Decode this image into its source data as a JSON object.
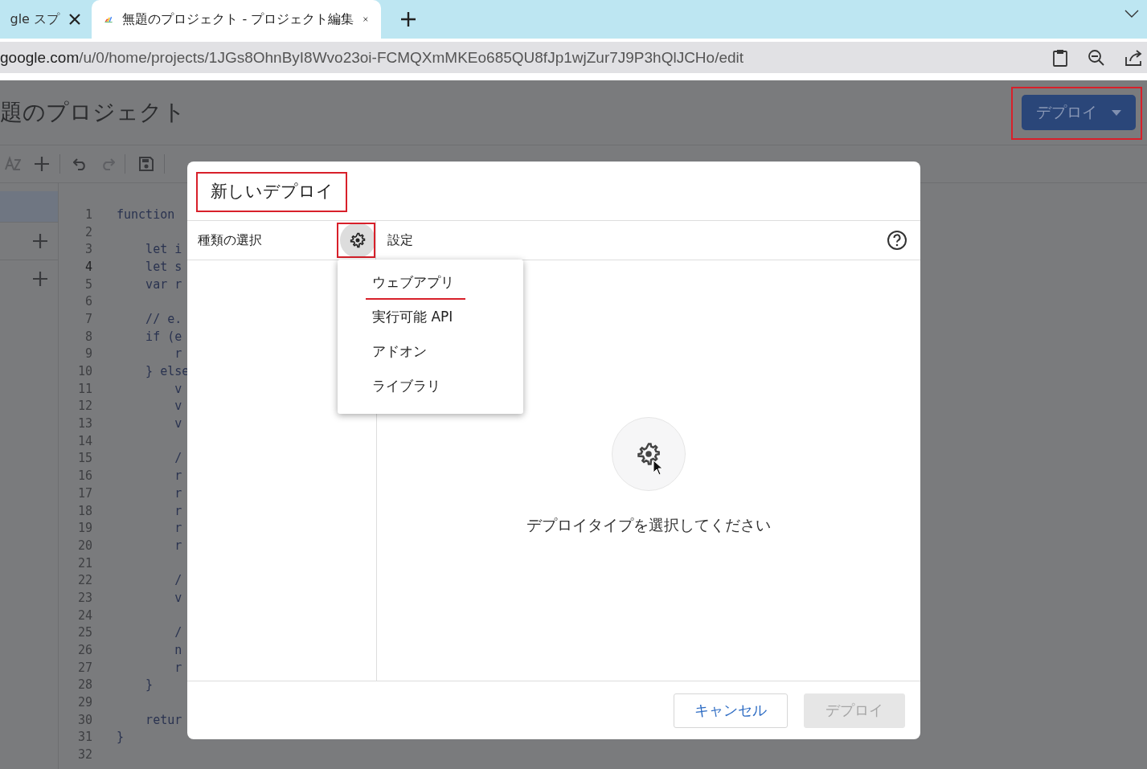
{
  "browser": {
    "tabs": [
      {
        "label": "gle スプ",
        "selected": false
      },
      {
        "label": "無題のプロジェクト - プロジェクト編集",
        "selected": true
      }
    ],
    "address": {
      "host": "google.com",
      "path": "/u/0/home/projects/1JGs8OhnByI8Wvo23oi-FCMQXmMKEo685QU8fJp1wjZur7J9P3hQlJCHo/edit"
    }
  },
  "app": {
    "title": "題のプロジェクト",
    "deploy_button": "デプロイ",
    "code_lines": [
      {
        "number": "1",
        "text": "function",
        "current": false
      },
      {
        "number": "2",
        "current": false
      },
      {
        "number": "3",
        "text": "    let i",
        "current": false
      },
      {
        "number": "4",
        "text": "    let s",
        "current": true
      },
      {
        "number": "5",
        "text": "    var r",
        "current": false
      },
      {
        "number": "6",
        "current": false
      },
      {
        "number": "7",
        "text": "    // e.",
        "current": false
      },
      {
        "number": "8",
        "text": "    if (e",
        "current": false
      },
      {
        "number": "9",
        "text": "        r",
        "current": false
      },
      {
        "number": "10",
        "text": "    } else",
        "current": false
      },
      {
        "number": "11",
        "text": "        v",
        "current": false
      },
      {
        "number": "12",
        "text": "        v",
        "current": false
      },
      {
        "number": "13",
        "text": "        v",
        "current": false
      },
      {
        "number": "14",
        "current": false
      },
      {
        "number": "15",
        "text": "        /",
        "current": false
      },
      {
        "number": "16",
        "text": "        r",
        "current": false
      },
      {
        "number": "17",
        "text": "        r",
        "current": false
      },
      {
        "number": "18",
        "text": "        r",
        "current": false
      },
      {
        "number": "19",
        "text": "        r",
        "current": false
      },
      {
        "number": "20",
        "text": "        r",
        "current": false
      },
      {
        "number": "21",
        "current": false
      },
      {
        "number": "22",
        "text": "        /",
        "current": false
      },
      {
        "number": "23",
        "text": "        v",
        "current": false
      },
      {
        "number": "24",
        "current": false
      },
      {
        "number": "25",
        "text": "        /",
        "current": false
      },
      {
        "number": "26",
        "text": "        n",
        "current": false
      },
      {
        "number": "27",
        "text": "        r",
        "current": false
      },
      {
        "number": "28",
        "text": "    }",
        "current": false
      },
      {
        "number": "29",
        "current": false
      },
      {
        "number": "30",
        "text": "    retur",
        "current": false
      },
      {
        "number": "31",
        "text": "}",
        "current": false
      },
      {
        "number": "32",
        "current": false
      }
    ]
  },
  "dialog": {
    "title": "新しいデプロイ",
    "type_label": "種類の選択",
    "settings_label": "設定",
    "menu": [
      {
        "label": "ウェブアプリ",
        "highlighted": true
      },
      {
        "label": "実行可能 API",
        "highlighted": false
      },
      {
        "label": "アドオン",
        "highlighted": false
      },
      {
        "label": "ライブラリ",
        "highlighted": false
      }
    ],
    "empty_message": "デプロイタイプを選択してください",
    "buttons": [
      {
        "label": "キャンセル",
        "disabled": false
      },
      {
        "label": "デプロイ",
        "disabled": true
      }
    ]
  }
}
